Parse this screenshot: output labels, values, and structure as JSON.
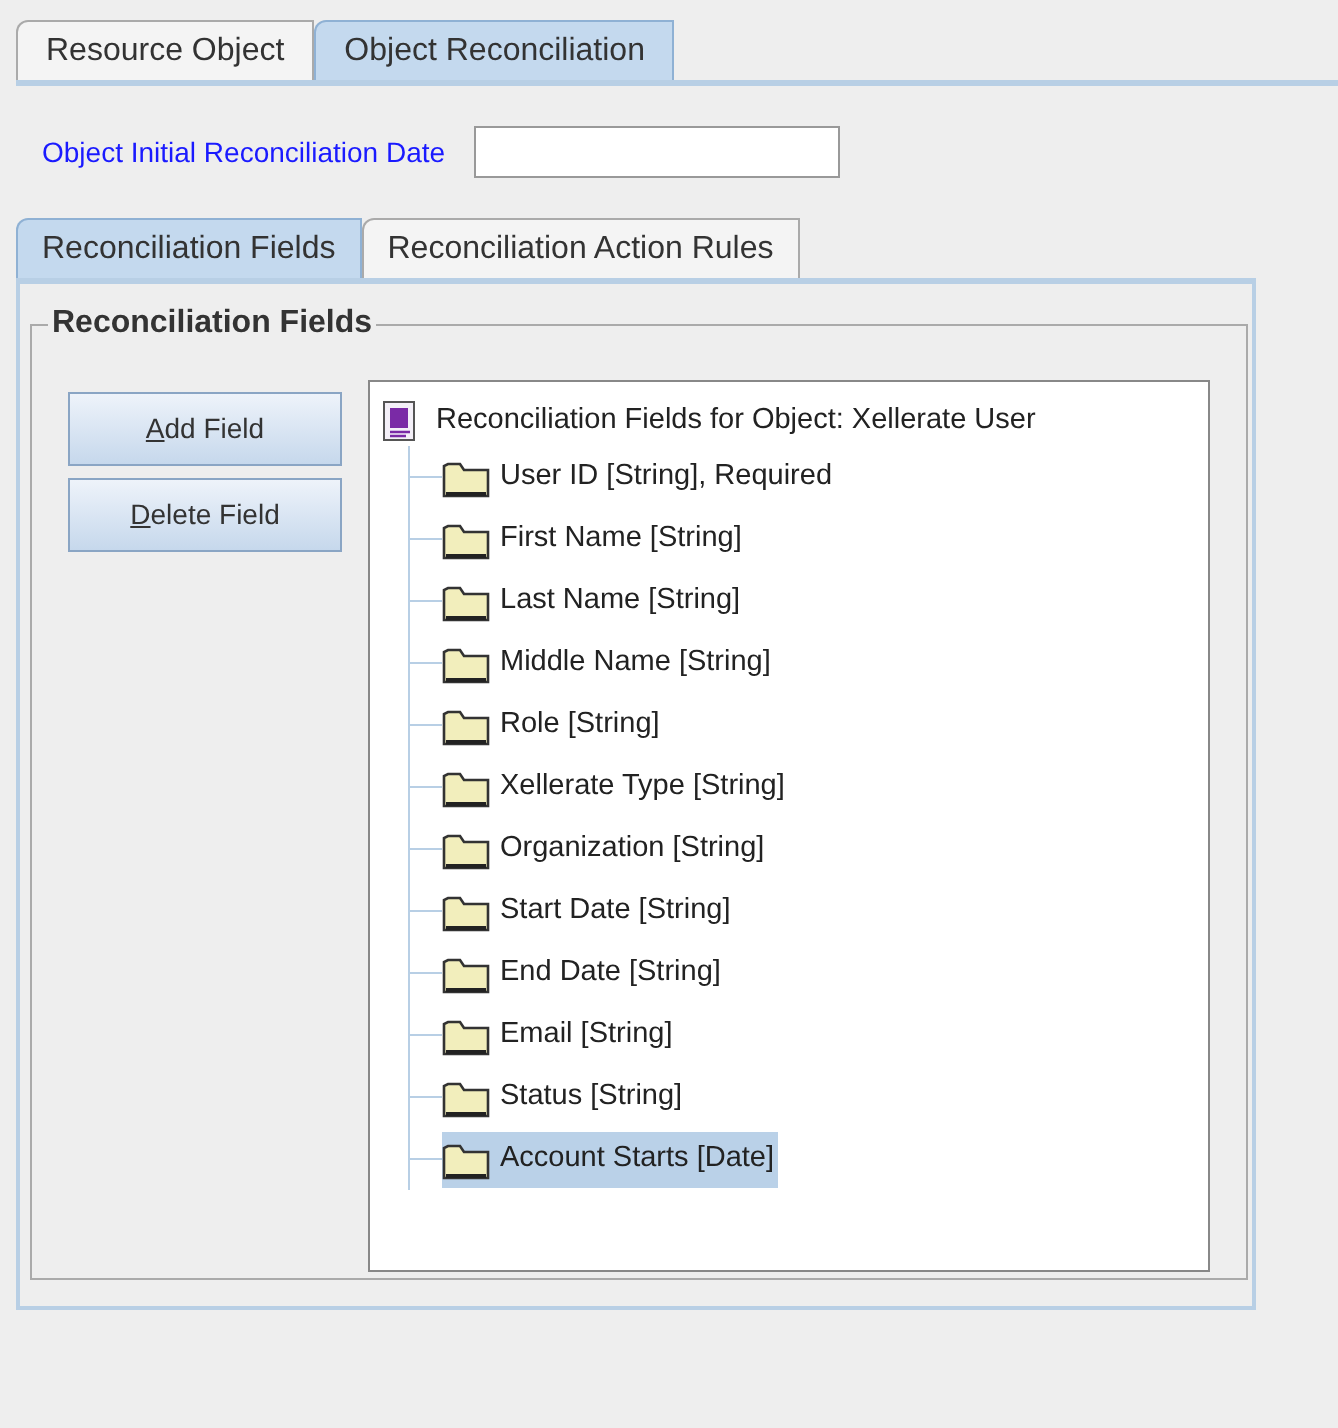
{
  "tabs": [
    {
      "label": "Resource Object",
      "selected": false
    },
    {
      "label": "Object Reconciliation",
      "selected": true
    }
  ],
  "date_field": {
    "label": "Object Initial Reconciliation Date"
  },
  "inner_tabs": [
    {
      "label": "Reconciliation Fields",
      "selected": true
    },
    {
      "label": "Reconciliation Action Rules",
      "selected": false
    }
  ],
  "group": {
    "title": "Reconciliation Fields"
  },
  "buttons": [
    "Add Field",
    "Delete Field"
  ],
  "tree": {
    "label": "Reconciliation Fields for Object: Xellerate User",
    "children": [
      {
        "label": "User ID [String], Required",
        "selected": false
      },
      {
        "label": "First Name [String]",
        "selected": false
      },
      {
        "label": "Last Name [String]",
        "selected": false
      },
      {
        "label": "Middle Name [String]",
        "selected": false
      },
      {
        "label": "Role [String]",
        "selected": false
      },
      {
        "label": "Xellerate Type [String]",
        "selected": false
      },
      {
        "label": "Organization [String]",
        "selected": false
      },
      {
        "label": "Start Date [String]",
        "selected": false
      },
      {
        "label": "End Date [String]",
        "selected": false
      },
      {
        "label": "Email [String]",
        "selected": false
      },
      {
        "label": "Status [String]",
        "selected": false
      },
      {
        "label": "Account Starts [Date]",
        "selected": true
      }
    ]
  }
}
